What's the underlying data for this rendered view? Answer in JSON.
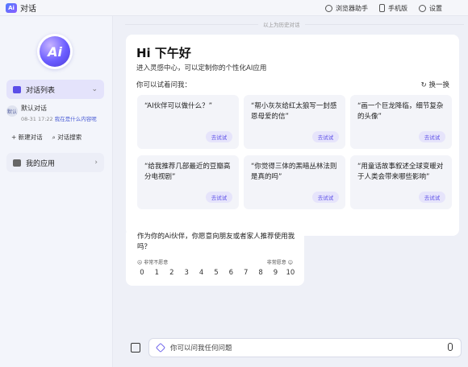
{
  "app": {
    "logo_text": "Ai",
    "title": "对话"
  },
  "topbar": {
    "actions": [
      {
        "icon": "browser-assistant-icon",
        "label": "浏览器助手"
      },
      {
        "icon": "phone-icon",
        "label": "手机版"
      },
      {
        "icon": "gear-icon",
        "label": "设置"
      }
    ]
  },
  "sidebar": {
    "logo_text": "Ai",
    "chat_list_label": "对话列表",
    "chat_item": {
      "avatar": "默认",
      "name": "默认对话",
      "time": "08-31 17:22",
      "preview": "我在是什么内容呢"
    },
    "new_chat": "+ 新建对话",
    "search_chat": "对话搜索",
    "my_apps": "我的应用"
  },
  "main": {
    "history_label": "以上为历史对话",
    "greeting": "Hi 下午好",
    "subtitle": "进入灵感中心，可以定制你的个性化AI应用",
    "try_label": "你可以试着问我：",
    "refresh_label": "换一换",
    "suggestions": [
      {
        "text": "“AI伙伴可以做什么？”",
        "button": "去试试"
      },
      {
        "text": "“帮小灰灰给红太狼写一封感恩母爱的信”",
        "button": "去试试"
      },
      {
        "text": "“画一个巨龙降临，细节复杂的头像”",
        "button": "去试试"
      },
      {
        "text": "“给我推荐几部最近的豆瓣高分电视剧”",
        "button": "去试试"
      },
      {
        "text": "“你觉得三体的黑暗丛林法则是真的吗”",
        "button": "去试试"
      },
      {
        "text": "“用童话故事叙述全球变暖对于人类会带来哪些影响”",
        "button": "去试试"
      }
    ],
    "survey": {
      "question": "作为你的Ai伙伴，你愿意向朋友或者家人推荐使用我吗？",
      "low_label": "非常不愿意",
      "high_label": "非常愿意",
      "scale": [
        "0",
        "1",
        "2",
        "3",
        "4",
        "5",
        "6",
        "7",
        "8",
        "9",
        "10"
      ]
    },
    "input": {
      "placeholder": "你可以问我任何问题"
    }
  },
  "colors": {
    "accent": "#5b4ee8",
    "background": "#eef0f7",
    "card": "#ffffff"
  }
}
